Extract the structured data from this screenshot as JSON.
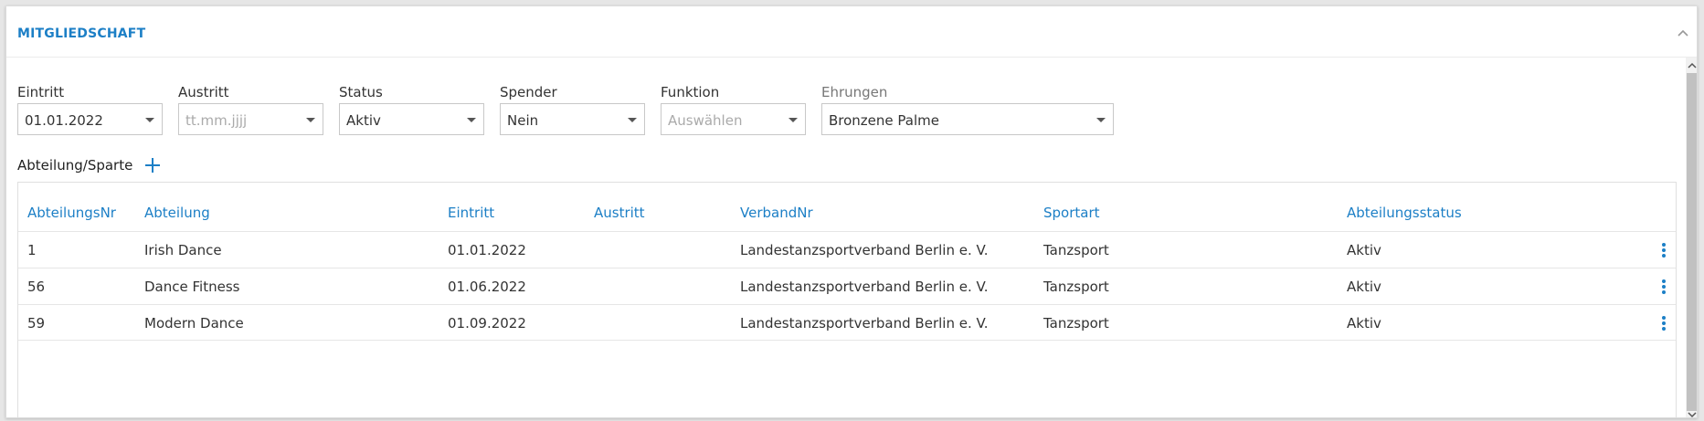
{
  "panel": {
    "title": "MITGLIEDSCHAFT"
  },
  "fields": {
    "eintritt": {
      "label": "Eintritt",
      "value": "01.01.2022"
    },
    "austritt": {
      "label": "Austritt",
      "placeholder": "tt.mm.jjjj"
    },
    "status": {
      "label": "Status",
      "value": "Aktiv"
    },
    "spender": {
      "label": "Spender",
      "value": "Nein"
    },
    "funktion": {
      "label": "Funktion",
      "placeholder": "Auswählen"
    },
    "ehrungen": {
      "label": "Ehrungen",
      "value": "Bronzene Palme"
    }
  },
  "section": {
    "label": "Abteilung/Sparte"
  },
  "table": {
    "headers": {
      "nr": "AbteilungsNr",
      "abteilung": "Abteilung",
      "eintritt": "Eintritt",
      "austritt": "Austritt",
      "verband": "VerbandNr",
      "sportart": "Sportart",
      "status": "Abteilungsstatus"
    },
    "rows": [
      {
        "nr": "1",
        "abteilung": "Irish Dance",
        "eintritt": "01.01.2022",
        "austritt": "",
        "verband": "Landestanzsportverband Berlin e. V.",
        "sportart": "Tanzsport",
        "status": "Aktiv"
      },
      {
        "nr": "56",
        "abteilung": "Dance Fitness",
        "eintritt": "01.06.2022",
        "austritt": "",
        "verband": "Landestanzsportverband Berlin e. V.",
        "sportart": "Tanzsport",
        "status": "Aktiv"
      },
      {
        "nr": "59",
        "abteilung": "Modern Dance",
        "eintritt": "01.09.2022",
        "austritt": "",
        "verband": "Landestanzsportverband Berlin e. V.",
        "sportart": "Tanzsport",
        "status": "Aktiv"
      }
    ]
  },
  "colors": {
    "accent": "#1c7fc6",
    "border": "#c8c8c8",
    "placeholder": "#aaaaaa"
  }
}
